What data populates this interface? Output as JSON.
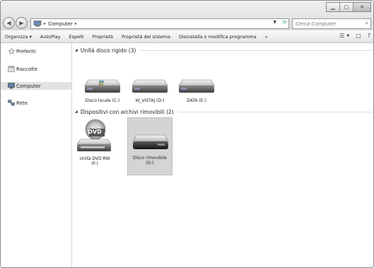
{
  "address": {
    "crumb": "Computer"
  },
  "search": {
    "placeholder": "Cerca Computer"
  },
  "toolbar": {
    "items": [
      "Organizza ▾",
      "AutoPlay",
      "Espelli",
      "Proprietà",
      "Proprietà del sistema",
      "Disinstalla o modifica programma",
      "»"
    ]
  },
  "sidebar": {
    "items": [
      {
        "label": "Preferiti",
        "icon": "star-icon"
      },
      {
        "label": "Raccolte",
        "icon": "library-icon"
      },
      {
        "label": "Computer",
        "icon": "computer-icon",
        "selected": true
      },
      {
        "label": "Rete",
        "icon": "network-icon"
      }
    ]
  },
  "groups": {
    "hdd": {
      "title": "Unità disco rigido (3)",
      "drives": [
        {
          "label": "Disco locale (C:)",
          "icon": "system-drive-icon"
        },
        {
          "label": "W_VISTAJ (D:)",
          "icon": "hard-drive-icon"
        },
        {
          "label": "DATA (E:)",
          "icon": "hard-drive-icon"
        }
      ]
    },
    "removable": {
      "title": "Dispositivi con archivi rimovibili (2)",
      "drives": [
        {
          "label_line1": "Unità DVD RW",
          "label_line2": "(F:)",
          "icon": "dvd-drive-icon"
        },
        {
          "label_line1": "Disco rimovibile",
          "label_line2": "(G:)",
          "icon": "removable-disk-icon",
          "selected": true
        }
      ]
    }
  },
  "dvd_badge": "DVD"
}
